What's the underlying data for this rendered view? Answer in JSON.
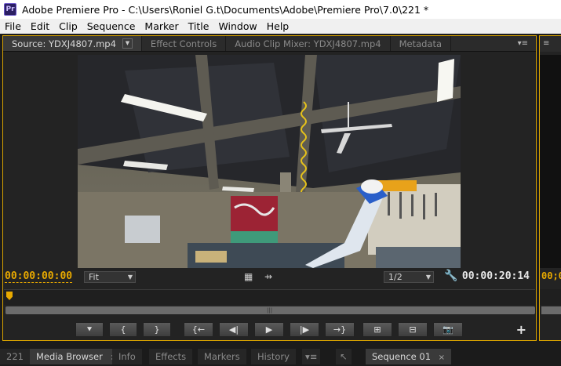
{
  "window": {
    "title": "Adobe Premiere Pro - C:\\Users\\Roniel G.t\\Documents\\Adobe\\Premiere Pro\\7.0\\221 *",
    "app_icon_label": "Pr"
  },
  "menu": [
    "File",
    "Edit",
    "Clip",
    "Sequence",
    "Marker",
    "Title",
    "Window",
    "Help"
  ],
  "source_panel": {
    "tabs": [
      {
        "label": "Source: YDXJ4807.mp4",
        "active": true
      },
      {
        "label": "Effect Controls",
        "active": false
      },
      {
        "label": "Audio Clip Mixer: YDXJ4807.mp4",
        "active": false
      },
      {
        "label": "Metadata",
        "active": false
      }
    ],
    "panel_menu_icon": "panel-menu-icon",
    "current_timecode": "00:00:00:00",
    "duration_timecode": "00:00:20:14",
    "zoom_select": "Fit",
    "resolution_select": "1/2",
    "transport_buttons": [
      {
        "name": "add-marker-button",
        "glyph": "⯆"
      },
      {
        "name": "mark-in-button",
        "glyph": "{"
      },
      {
        "name": "mark-out-button",
        "glyph": "}"
      },
      {
        "name": "go-to-in-button",
        "glyph": "{←"
      },
      {
        "name": "step-back-button",
        "glyph": "◀|"
      },
      {
        "name": "play-button",
        "glyph": "▶"
      },
      {
        "name": "step-forward-button",
        "glyph": "|▶"
      },
      {
        "name": "go-to-out-button",
        "glyph": "→}"
      },
      {
        "name": "insert-button",
        "glyph": "⊞"
      },
      {
        "name": "overwrite-button",
        "glyph": "⊟"
      },
      {
        "name": "export-frame-button",
        "glyph": "📷"
      }
    ],
    "add_button": "+"
  },
  "right_panel": {
    "tab_icon": "panel-menu-icon",
    "timecode": "00;0"
  },
  "bottom_tabs": [
    {
      "label": "221",
      "active": false
    },
    {
      "label": "Media Browser",
      "active": true,
      "close": "×"
    },
    {
      "label": "Info",
      "active": false
    },
    {
      "label": "Effects",
      "active": false
    },
    {
      "label": "Markers",
      "active": false
    },
    {
      "label": "History",
      "active": false
    },
    {
      "label": "Sequence 01",
      "active": true,
      "close": "×"
    }
  ]
}
